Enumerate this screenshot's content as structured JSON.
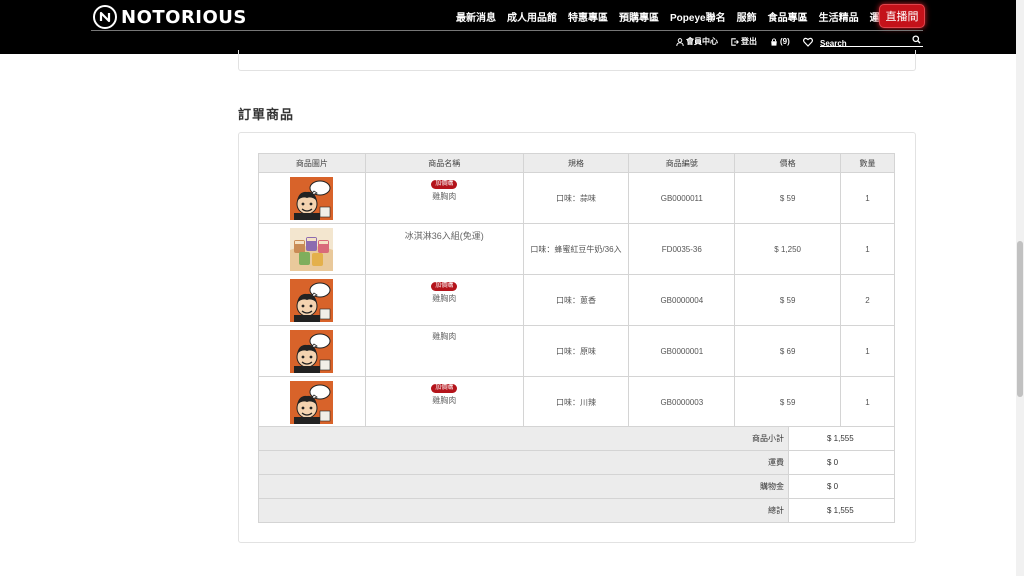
{
  "header": {
    "brand": "NOTORIOUS",
    "nav": [
      "最新消息",
      "成人用品館",
      "特惠專區",
      "預購專區",
      "Popeye聯名",
      "服飾",
      "食品專區",
      "生活精品",
      "運動保健"
    ],
    "live_label": "直播間",
    "subnav": {
      "member": "會員中心",
      "logout": "登出",
      "cart": "(9)"
    },
    "search_placeholder": "Search"
  },
  "section_title": "訂單商品",
  "table": {
    "headers": [
      "商品圖片",
      "商品名稱",
      "規格",
      "商品編號",
      "價格",
      "數量"
    ],
    "badge_label": "加價購",
    "rows": [
      {
        "name": "雞胸肉",
        "badge": true,
        "spec": "口味：蒜味",
        "code": "GB0000011",
        "price": "$ 59",
        "qty": "1",
        "image": "chicken-breast"
      },
      {
        "name": "冰淇淋36入組(免運)",
        "badge": false,
        "spec": "口味：蜂蜜紅豆牛奶/36入",
        "code": "FD0035-36",
        "price": "$ 1,250",
        "qty": "1",
        "image": "ice-cream-set"
      },
      {
        "name": "雞胸肉",
        "badge": true,
        "spec": "口味：蔥香",
        "code": "GB0000004",
        "price": "$ 59",
        "qty": "2",
        "image": "chicken-breast"
      },
      {
        "name": "雞胸肉",
        "badge": false,
        "spec": "口味：原味",
        "code": "GB0000001",
        "price": "$ 69",
        "qty": "1",
        "image": "chicken-breast"
      },
      {
        "name": "雞胸肉",
        "badge": true,
        "spec": "口味：川辣",
        "code": "GB0000003",
        "price": "$ 59",
        "qty": "1",
        "image": "chicken-breast"
      }
    ]
  },
  "totals": [
    {
      "label": "商品小計",
      "value": "$ 1,555"
    },
    {
      "label": "運費",
      "value": "$ 0"
    },
    {
      "label": "購物金",
      "value": "$ 0"
    },
    {
      "label": "總計",
      "value": "$ 1,555"
    }
  ],
  "colors": {
    "header_bg": "#000000",
    "accent_red": "#c4121a",
    "badge_red": "#b4141b",
    "table_head_bg": "#ececec"
  }
}
